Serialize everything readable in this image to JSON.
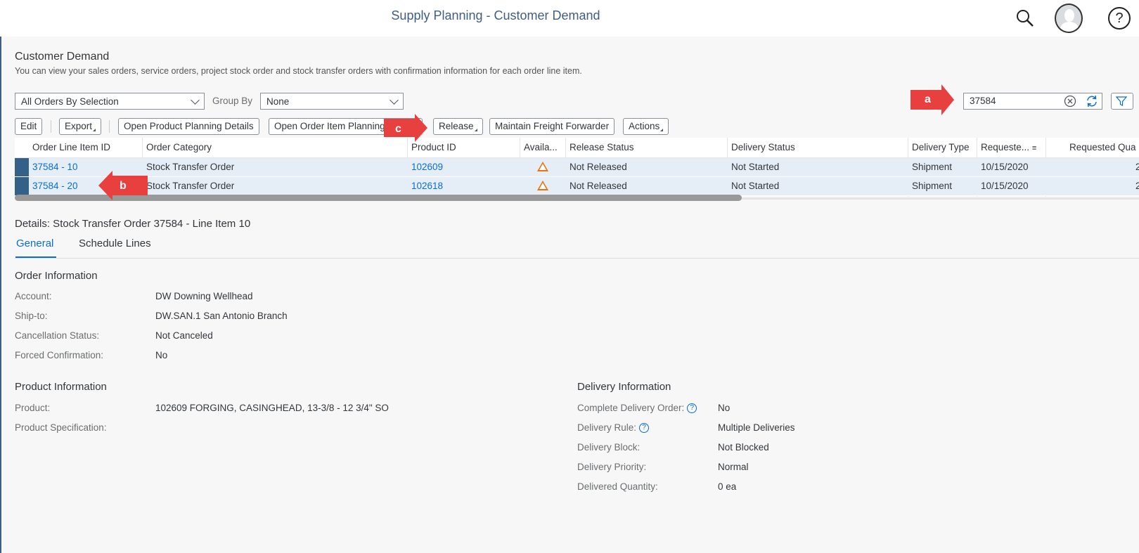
{
  "shell": {
    "title": "Supply Planning - Customer Demand"
  },
  "header": {
    "title": "Customer Demand",
    "subtitle": "You can view your sales orders, service orders, project stock order and stock transfer orders with confirmation information for each order line item."
  },
  "filters": {
    "view_select": "All Orders By Selection",
    "group_by_label": "Group By",
    "group_by_value": "None",
    "search_value": "37584"
  },
  "toolbar": {
    "edit": "Edit",
    "export": "Export",
    "open_product_planning": "Open Product Planning Details",
    "open_order_item_planning": "Open Order Item Planning",
    "release": "Release",
    "maintain_freight": "Maintain Freight Forwarder",
    "actions": "Actions"
  },
  "table": {
    "columns": [
      "Order Line Item ID",
      "Order Category",
      "Product ID",
      "Availa...",
      "Release Status",
      "Delivery Status",
      "Delivery Type",
      "Requeste...",
      "Requested Qua"
    ],
    "rows": [
      {
        "id": "37584 - 10",
        "category": "Stock Transfer Order",
        "product": "102609",
        "release": "Not Released",
        "delivery_status": "Not Started",
        "delivery_type": "Shipment",
        "requested": "10/15/2020",
        "qty": "2"
      },
      {
        "id": "37584 - 20",
        "category": "Stock Transfer Order",
        "product": "102618",
        "release": "Not Released",
        "delivery_status": "Not Started",
        "delivery_type": "Shipment",
        "requested": "10/15/2020",
        "qty": "2"
      }
    ]
  },
  "details": {
    "title": "Details: Stock Transfer Order 37584 - Line Item 10",
    "tabs": [
      "General",
      "Schedule Lines"
    ],
    "order_info": {
      "title": "Order Information",
      "account_label": "Account:",
      "account_value": "DW Downing Wellhead",
      "shipto_label": "Ship-to:",
      "shipto_value": "DW.SAN.1 San Antonio Branch",
      "cancel_label": "Cancellation Status:",
      "cancel_value": "Not Canceled",
      "forced_label": "Forced Confirmation:",
      "forced_value": "No"
    },
    "product_info": {
      "title": "Product Information",
      "product_label": "Product:",
      "product_value": "102609 FORGING, CASINGHEAD, 13-3/8 - 12 3/4\" SO",
      "spec_label": "Product Specification:"
    },
    "delivery_info": {
      "title": "Delivery Information",
      "complete_label": "Complete Delivery Order:",
      "complete_value": "No",
      "rule_label": "Delivery Rule:",
      "rule_value": "Multiple Deliveries",
      "block_label": "Delivery Block:",
      "block_value": "Not Blocked",
      "priority_label": "Delivery Priority:",
      "priority_value": "Normal",
      "delivered_label": "Delivered Quantity:",
      "delivered_value": "0 ea"
    }
  },
  "callouts": {
    "a": "a",
    "b": "b",
    "c": "c"
  },
  "colors": {
    "accent": "#0a6ed1",
    "shell_title": "#3f5e82",
    "warning": "#e9730c",
    "callout": "#e8403f",
    "selected_row": "#e5eef7"
  }
}
